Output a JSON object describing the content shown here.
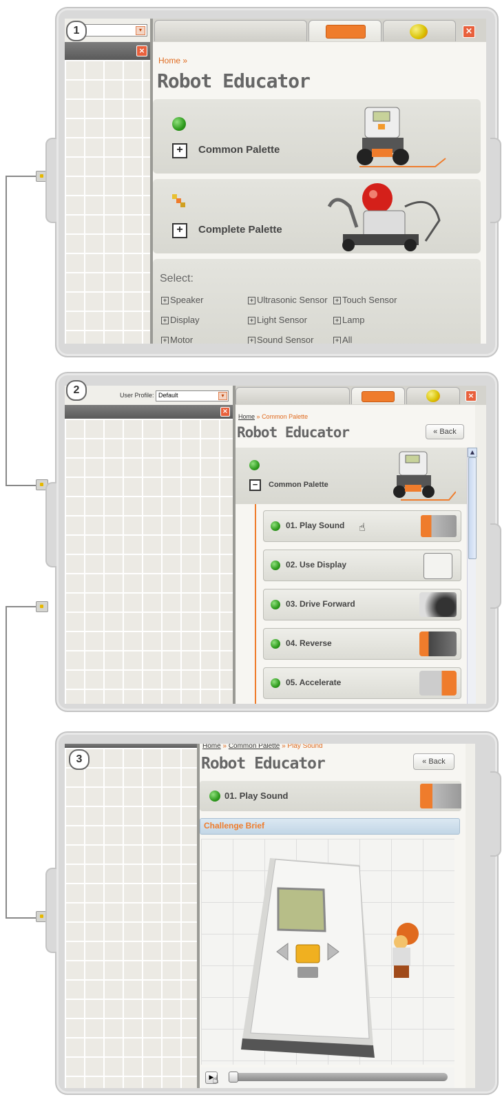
{
  "common": {
    "app_title": "Robot Educator",
    "home": "Home",
    "sep": "»",
    "common_palette": "Common Palette",
    "complete_palette": "Complete Palette",
    "back": "« Back"
  },
  "step1": {
    "number": "1",
    "select_label": "Select:",
    "select_items": [
      "Speaker",
      "Ultrasonic Sensor",
      "Touch Sensor",
      "Display",
      "Light Sensor",
      "Lamp",
      "Motor",
      "Sound Sensor",
      "All"
    ]
  },
  "step2": {
    "number": "2",
    "user_profile_label": "User Profile:",
    "user_profile_value": "Default",
    "lessons": [
      "01. Play Sound",
      "02. Use Display",
      "03. Drive Forward",
      "04. Reverse",
      "05. Accelerate"
    ]
  },
  "step3": {
    "number": "3",
    "lesson_title": "01. Play Sound",
    "challenge_brief": "Challenge Brief",
    "breadcrumb_current": "Play Sound"
  },
  "colors": {
    "accent_orange": "#e06a1e",
    "status_green": "#2e9a1d",
    "close_red": "#e8603c"
  }
}
